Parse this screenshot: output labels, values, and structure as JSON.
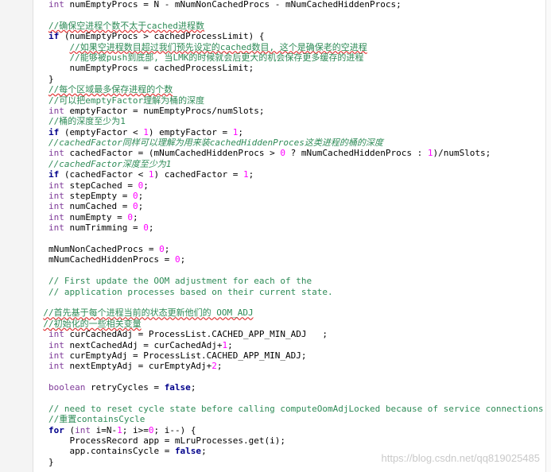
{
  "editor": {
    "lines": [
      {
        "indent": 8,
        "segments": [
          {
            "t": "int",
            "c": "ty"
          },
          {
            "t": " numEmptyProcs = N - mNumNonCachedProcs - mNumCachedHiddenProcs;"
          }
        ]
      },
      {
        "indent": 0,
        "segments": []
      },
      {
        "indent": 8,
        "segments": [
          {
            "t": "//确保空进程个数不太于cached进程数",
            "c": "cmt sq"
          }
        ]
      },
      {
        "indent": 8,
        "segments": [
          {
            "t": "if",
            "c": "kw"
          },
          {
            "t": " (numEmptyProcs > cachedProcessLimit) {"
          }
        ]
      },
      {
        "indent": 12,
        "segments": [
          {
            "t": "//如果空进程数目超过我们预先设定的cached数目, 这个是确保老的空进程",
            "c": "cmt sq"
          }
        ]
      },
      {
        "indent": 12,
        "segments": [
          {
            "t": "//能够被push到底部, 当LMK的时候就会后更大的机会保存更多缓存的进程",
            "c": "cmt"
          }
        ]
      },
      {
        "indent": 12,
        "segments": [
          {
            "t": "numEmptyProcs = cachedProcessLimit;"
          }
        ]
      },
      {
        "indent": 8,
        "segments": [
          {
            "t": "}"
          }
        ]
      },
      {
        "indent": 8,
        "segments": [
          {
            "t": "//每个区域最多保存进程的个数",
            "c": "cmt sq"
          }
        ]
      },
      {
        "indent": 8,
        "segments": [
          {
            "t": "//可以把emptyFactor理解为桶的深度",
            "c": "cmt"
          }
        ]
      },
      {
        "indent": 8,
        "segments": [
          {
            "t": "int",
            "c": "ty"
          },
          {
            "t": " emptyFactor = numEmptyProcs/numSlots;"
          }
        ]
      },
      {
        "indent": 8,
        "segments": [
          {
            "t": "//桶的深度至少为1",
            "c": "cmt"
          }
        ]
      },
      {
        "indent": 8,
        "segments": [
          {
            "t": "if",
            "c": "kw"
          },
          {
            "t": " (emptyFactor < "
          },
          {
            "t": "1",
            "c": "num"
          },
          {
            "t": ") emptyFactor = "
          },
          {
            "t": "1",
            "c": "num"
          },
          {
            "t": ";"
          }
        ]
      },
      {
        "indent": 8,
        "segments": [
          {
            "t": "//cachedFactor同样可以理解为用来装cachedHiddenProces这类进程的桶的深度",
            "c": "cmt-i"
          }
        ]
      },
      {
        "indent": 8,
        "segments": [
          {
            "t": "int",
            "c": "ty"
          },
          {
            "t": " cachedFactor = (mNumCachedHiddenProcs > "
          },
          {
            "t": "0",
            "c": "num"
          },
          {
            "t": " ? mNumCachedHiddenProcs : "
          },
          {
            "t": "1",
            "c": "num"
          },
          {
            "t": ")/numSlots;"
          }
        ]
      },
      {
        "indent": 8,
        "segments": [
          {
            "t": "//cachedFactor深度至少为1",
            "c": "cmt-i"
          }
        ]
      },
      {
        "indent": 8,
        "segments": [
          {
            "t": "if",
            "c": "kw"
          },
          {
            "t": " (cachedFactor < "
          },
          {
            "t": "1",
            "c": "num"
          },
          {
            "t": ") cachedFactor = "
          },
          {
            "t": "1",
            "c": "num"
          },
          {
            "t": ";"
          }
        ]
      },
      {
        "indent": 8,
        "segments": [
          {
            "t": "int",
            "c": "ty"
          },
          {
            "t": " stepCached = "
          },
          {
            "t": "0",
            "c": "num"
          },
          {
            "t": ";"
          }
        ]
      },
      {
        "indent": 8,
        "segments": [
          {
            "t": "int",
            "c": "ty"
          },
          {
            "t": " stepEmpty = "
          },
          {
            "t": "0",
            "c": "num"
          },
          {
            "t": ";"
          }
        ]
      },
      {
        "indent": 8,
        "segments": [
          {
            "t": "int",
            "c": "ty"
          },
          {
            "t": " numCached = "
          },
          {
            "t": "0",
            "c": "num"
          },
          {
            "t": ";"
          }
        ]
      },
      {
        "indent": 8,
        "segments": [
          {
            "t": "int",
            "c": "ty"
          },
          {
            "t": " numEmpty = "
          },
          {
            "t": "0",
            "c": "num"
          },
          {
            "t": ";"
          }
        ]
      },
      {
        "indent": 8,
        "segments": [
          {
            "t": "int",
            "c": "ty"
          },
          {
            "t": " numTrimming = "
          },
          {
            "t": "0",
            "c": "num"
          },
          {
            "t": ";"
          }
        ]
      },
      {
        "indent": 0,
        "segments": []
      },
      {
        "indent": 8,
        "segments": [
          {
            "t": "mNumNonCachedProcs = "
          },
          {
            "t": "0",
            "c": "num"
          },
          {
            "t": ";"
          }
        ]
      },
      {
        "indent": 8,
        "segments": [
          {
            "t": "mNumCachedHiddenProcs = "
          },
          {
            "t": "0",
            "c": "num"
          },
          {
            "t": ";"
          }
        ]
      },
      {
        "indent": 0,
        "segments": []
      },
      {
        "indent": 8,
        "segments": [
          {
            "t": "// First update the OOM adjustment for each of the",
            "c": "cmt"
          }
        ]
      },
      {
        "indent": 8,
        "segments": [
          {
            "t": "// application processes based on their current state.",
            "c": "cmt"
          }
        ]
      },
      {
        "indent": 0,
        "segments": []
      },
      {
        "indent": 7,
        "segments": [
          {
            "t": "//首先基于每个进程当前的状态更新他们的 OOM_ADJ",
            "c": "cmt sq"
          }
        ]
      },
      {
        "indent": 7,
        "segments": [
          {
            "t": "//初始化的一些相关变量",
            "c": "cmt sq"
          }
        ]
      },
      {
        "indent": 8,
        "segments": [
          {
            "t": "int",
            "c": "ty"
          },
          {
            "t": " curCachedAdj = ProcessList.CACHED_APP_MIN_ADJ   ;"
          }
        ]
      },
      {
        "indent": 8,
        "segments": [
          {
            "t": "int",
            "c": "ty"
          },
          {
            "t": " nextCachedAdj = curCachedAdj+"
          },
          {
            "t": "1",
            "c": "num"
          },
          {
            "t": ";"
          }
        ]
      },
      {
        "indent": 8,
        "segments": [
          {
            "t": "int",
            "c": "ty"
          },
          {
            "t": " curEmptyAdj = ProcessList.CACHED_APP_MIN_ADJ;"
          }
        ]
      },
      {
        "indent": 8,
        "segments": [
          {
            "t": "int",
            "c": "ty"
          },
          {
            "t": " nextEmptyAdj = curEmptyAdj+"
          },
          {
            "t": "2",
            "c": "num"
          },
          {
            "t": ";"
          }
        ]
      },
      {
        "indent": 0,
        "segments": []
      },
      {
        "indent": 8,
        "segments": [
          {
            "t": "boolean",
            "c": "ty"
          },
          {
            "t": " retryCycles = "
          },
          {
            "t": "false",
            "c": "kw"
          },
          {
            "t": ";"
          }
        ]
      },
      {
        "indent": 0,
        "segments": []
      },
      {
        "indent": 8,
        "segments": [
          {
            "t": "// need to reset cycle state before calling computeOomAdjLocked because of service connections",
            "c": "cmt"
          }
        ]
      },
      {
        "indent": 8,
        "segments": [
          {
            "t": "//重置containsCycle",
            "c": "cmt"
          }
        ]
      },
      {
        "indent": 8,
        "segments": [
          {
            "t": "for",
            "c": "kw"
          },
          {
            "t": " ("
          },
          {
            "t": "int",
            "c": "ty"
          },
          {
            "t": " i=N-"
          },
          {
            "t": "1",
            "c": "num"
          },
          {
            "t": "; i>="
          },
          {
            "t": "0",
            "c": "num"
          },
          {
            "t": "; i--) {"
          }
        ]
      },
      {
        "indent": 12,
        "segments": [
          {
            "t": "ProcessRecord app = mLruProcesses.get(i);"
          }
        ]
      },
      {
        "indent": 12,
        "segments": [
          {
            "t": "app.containsCycle = "
          },
          {
            "t": "false",
            "c": "kw"
          },
          {
            "t": ";"
          }
        ]
      },
      {
        "indent": 8,
        "segments": [
          {
            "t": "}"
          }
        ]
      }
    ]
  },
  "watermark": "https://blog.csdn.net/qq819025485"
}
